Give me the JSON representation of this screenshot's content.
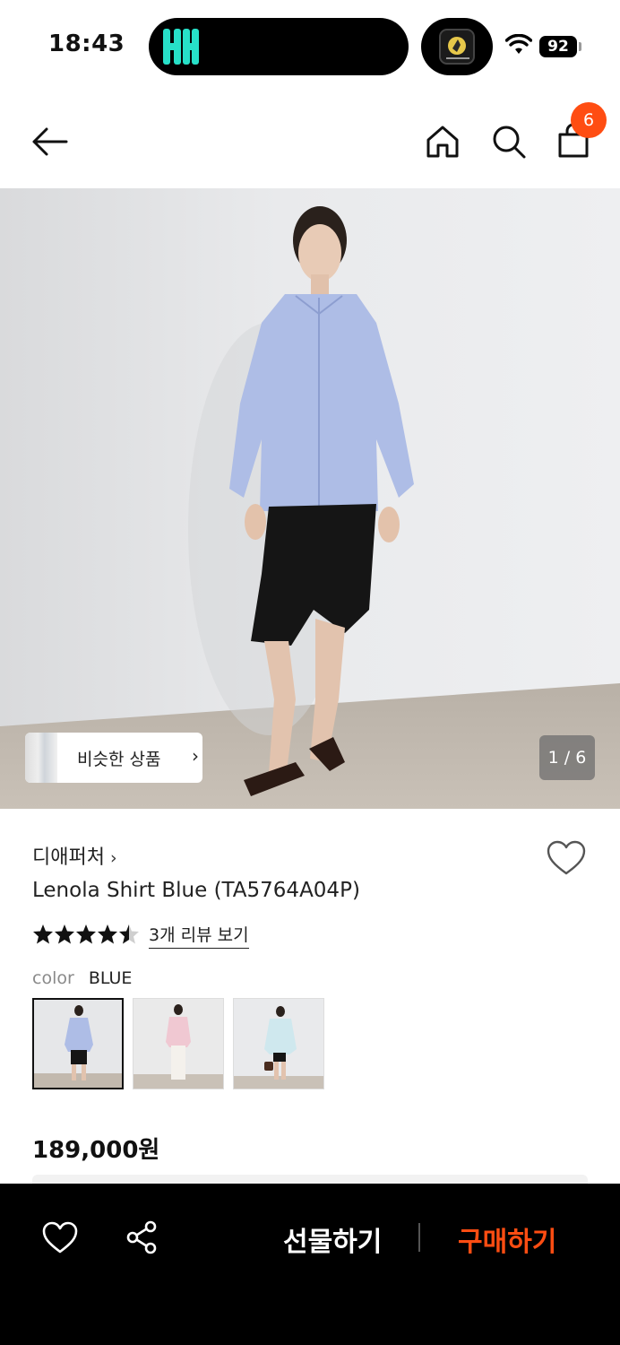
{
  "status_bar": {
    "time": "18:43",
    "battery": "92"
  },
  "nav": {
    "cart_count": "6"
  },
  "hero": {
    "similar_label": "비슷한 상품",
    "page_indicator": "1 / 6"
  },
  "product": {
    "brand": "디애퍼처",
    "name": "Lenola Shirt Blue (TA5764A04P)",
    "rating_stars": 4.5,
    "review_link": "3개 리뷰 보기",
    "color_label": "color",
    "color_value": "BLUE",
    "price": "189,000원"
  },
  "bottom_bar": {
    "gift_label": "선물하기",
    "buy_label": "구매하기"
  },
  "colors": {
    "accent": "#ff4d12",
    "bottom_bar_bg": "#000000"
  }
}
